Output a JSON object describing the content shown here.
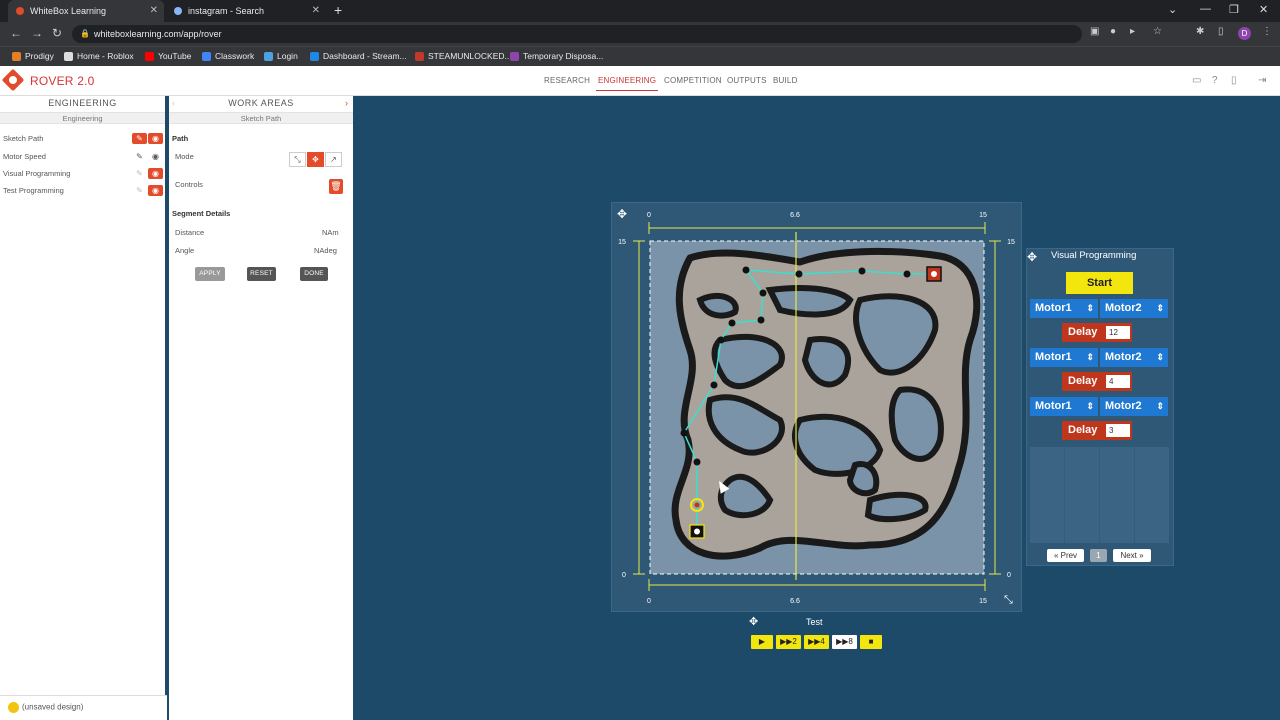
{
  "browser": {
    "tabs": [
      {
        "title": "WhiteBox Learning",
        "favicon_color": "#e34b2b"
      },
      {
        "title": "instagram - Search",
        "favicon_color": "#8ab4f8"
      }
    ],
    "url": "whiteboxlearning.com/app/rover",
    "bookmarks": [
      "Prodigy",
      "Home - Roblox",
      "YouTube",
      "Classwork",
      "Login",
      "Dashboard - Stream...",
      "STEAMUNLOCKED...",
      "Temporary Disposa..."
    ]
  },
  "app": {
    "brand": "ROVER 2.0",
    "nav": [
      "RESEARCH",
      "ENGINEERING",
      "COMPETITION",
      "OUTPUTS",
      "BUILD"
    ],
    "active_nav": "ENGINEERING"
  },
  "left_panel": {
    "title": "ENGINEERING",
    "subtitle": "Engineering",
    "items": [
      "Sketch Path",
      "Motor Speed",
      "Visual Programming",
      "Test Programming"
    ]
  },
  "work_panel": {
    "title": "WORK AREAS",
    "subtitle": "Sketch Path",
    "section_path": "Path",
    "mode_label": "Mode",
    "controls_label": "Controls",
    "section_segment": "Segment Details",
    "distance_label": "Distance",
    "distance_value": "NAm",
    "angle_label": "Angle",
    "angle_value": "NAdeg",
    "buttons": [
      "APPLY",
      "RESET",
      "DONE"
    ]
  },
  "map": {
    "ruler_top": [
      "0",
      "6.6",
      "15"
    ],
    "ruler_bottom": [
      "0",
      "6.6",
      "15"
    ],
    "ruler_left_top": "15",
    "ruler_left_bottom": "0",
    "ruler_right_top": "15",
    "ruler_right_bottom": "0",
    "track_color": "#a9a39b",
    "path_color": "#37e0d0"
  },
  "visual_programming": {
    "title": "Visual Programming",
    "start_label": "Start",
    "motor1_label": "Motor1",
    "motor2_label": "Motor2",
    "delay_label": "Delay",
    "delays": [
      "12",
      "4",
      "3"
    ],
    "prev_label": "« Prev",
    "page": "1",
    "next_label": "Next »"
  },
  "test": {
    "label": "Test",
    "buttons": [
      "▶",
      "▶▶2",
      "▶▶4",
      "▶▶8",
      "■"
    ]
  },
  "status": {
    "text": "(unsaved design)"
  }
}
